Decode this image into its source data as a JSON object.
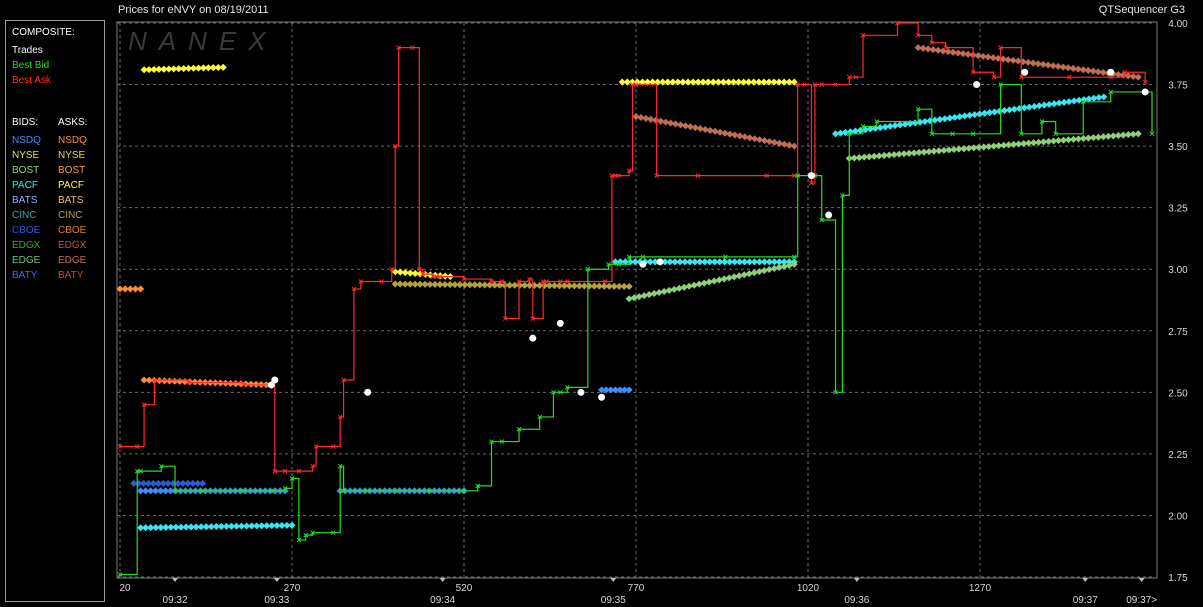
{
  "header": {
    "title": "Prices for  eNVY  on  08/19/2011",
    "product": "QTSequencer G3"
  },
  "watermark": "NANEX",
  "legend": {
    "composite_title": "COMPOSITE:",
    "composite_items": [
      {
        "label": "Trades",
        "color": "#ffffff"
      },
      {
        "label": "Best Bid",
        "color": "#22e022"
      },
      {
        "label": "Best Ask",
        "color": "#ff2a2a"
      }
    ],
    "bids_title": "BIDS:",
    "asks_title": "ASKS:",
    "exchanges": [
      {
        "bid": "NSDQ",
        "bid_color": "#3f8cff",
        "ask": "NSDQ",
        "ask_color": "#ff8a3a"
      },
      {
        "bid": "NYSE",
        "bid_color": "#d8e640",
        "ask": "NYSE",
        "ask_color": "#f2d35a"
      },
      {
        "bid": "BOST",
        "bid_color": "#8ed17a",
        "ask": "BOST",
        "ask_color": "#ff9a58"
      },
      {
        "bid": "PACF",
        "bid_color": "#37e6f2",
        "ask": "PACF",
        "ask_color": "#ffff3a"
      },
      {
        "bid": "BATS",
        "bid_color": "#8ab4ff",
        "ask": "BATS",
        "ask_color": "#e8c286"
      },
      {
        "bid": "CINC",
        "bid_color": "#3aa3a3",
        "ask": "CINC",
        "ask_color": "#b5a040"
      },
      {
        "bid": "CBOE",
        "bid_color": "#2a5cd0",
        "ask": "CBOE",
        "ask_color": "#d8862c"
      },
      {
        "bid": "EDGX",
        "bid_color": "#3aa832",
        "ask": "EDGX",
        "ask_color": "#b85a2a"
      },
      {
        "bid": "EDGE",
        "bid_color": "#6ac882",
        "ask": "EDGE",
        "ask_color": "#c06e56"
      },
      {
        "bid": "BATY",
        "bid_color": "#3f6fe0",
        "ask": "BATY",
        "ask_color": "#c2503a"
      }
    ]
  },
  "chart_data": {
    "type": "scatter",
    "title": "Prices for  eNVY  on  08/19/2011",
    "ylim": [
      1.75,
      4.0
    ],
    "xlim": [
      20,
      1520
    ],
    "y_ticks": [
      "1.75",
      "2.00",
      "2.25",
      "2.50",
      "2.75",
      "3.00",
      "3.25",
      "3.50",
      "3.75",
      "4.00"
    ],
    "y_tick_values": [
      1.75,
      2.0,
      2.25,
      2.5,
      2.75,
      3.0,
      3.25,
      3.5,
      3.75,
      4.0
    ],
    "x_ticks": [
      "20",
      "270",
      "520",
      "770",
      "1020",
      "1270"
    ],
    "x_tick_values": [
      20,
      270,
      520,
      770,
      1020,
      1270
    ],
    "time_labels": [
      {
        "label": "09:32",
        "x": 100
      },
      {
        "label": "09:33",
        "x": 248
      },
      {
        "label": "09:34",
        "x": 489
      },
      {
        "label": "09:35",
        "x": 737
      },
      {
        "label": "09:36",
        "x": 1091
      },
      {
        "label": "09:37",
        "x": 1423
      },
      {
        "label": "09:37>",
        "x": 1505
      }
    ],
    "grid": true,
    "series": [
      {
        "name": "Best Ask",
        "color": "#ff2a2a",
        "x": [
          20,
          45,
          55,
          70,
          120,
          200,
          240,
          245,
          260,
          280,
          300,
          305,
          330,
          340,
          345,
          360,
          370,
          400,
          415,
          420,
          425,
          445,
          455,
          460,
          475,
          480,
          485,
          520,
          560,
          575,
          580,
          600,
          615,
          620,
          635,
          640,
          660,
          670,
          725,
          735,
          740,
          745,
          760,
          765,
          770,
          800,
          860,
          960,
          1000,
          1005,
          1015,
          1025,
          1030,
          1040,
          1060,
          1080,
          1090,
          1100,
          1150,
          1180,
          1200,
          1220,
          1260,
          1290,
          1300,
          1330,
          1400,
          1460,
          1480,
          1510
        ],
        "y": [
          2.28,
          2.28,
          2.45,
          2.55,
          2.54,
          2.53,
          2.53,
          2.18,
          2.18,
          2.18,
          2.2,
          2.28,
          2.28,
          2.4,
          2.55,
          2.92,
          2.95,
          2.95,
          3.0,
          3.5,
          3.9,
          3.9,
          3.0,
          2.98,
          2.97,
          2.97,
          2.97,
          2.96,
          2.95,
          2.95,
          2.8,
          2.95,
          2.96,
          2.8,
          2.95,
          2.95,
          2.95,
          2.95,
          2.95,
          3.38,
          3.38,
          3.38,
          3.4,
          3.75,
          3.75,
          3.38,
          3.38,
          3.38,
          3.38,
          3.75,
          3.75,
          3.35,
          3.75,
          3.75,
          3.75,
          3.78,
          3.78,
          3.95,
          4.0,
          3.95,
          3.92,
          3.9,
          3.8,
          3.78,
          3.9,
          3.78,
          3.78,
          3.78,
          3.8,
          3.76
        ]
      },
      {
        "name": "Best Bid",
        "color": "#22e022",
        "x": [
          20,
          45,
          50,
          80,
          100,
          140,
          200,
          240,
          260,
          270,
          280,
          290,
          300,
          330,
          340,
          345,
          380,
          420,
          470,
          520,
          540,
          560,
          575,
          600,
          630,
          650,
          660,
          670,
          700,
          730,
          745,
          760,
          780,
          900,
          1000,
          1005,
          1030,
          1040,
          1060,
          1070,
          1080,
          1100,
          1120,
          1180,
          1200,
          1230,
          1260,
          1300,
          1330,
          1360,
          1380,
          1420,
          1460,
          1520
        ],
        "y": [
          1.76,
          2.18,
          2.18,
          2.2,
          2.1,
          2.1,
          2.1,
          2.1,
          2.11,
          2.15,
          1.9,
          1.92,
          1.93,
          1.93,
          2.2,
          2.1,
          2.1,
          2.1,
          2.1,
          2.1,
          2.12,
          2.3,
          2.3,
          2.35,
          2.4,
          2.5,
          2.5,
          2.52,
          3.0,
          3.02,
          3.02,
          3.05,
          3.05,
          3.05,
          3.05,
          3.38,
          3.38,
          3.2,
          2.5,
          3.3,
          3.55,
          3.58,
          3.6,
          3.65,
          3.55,
          3.55,
          3.55,
          3.75,
          3.55,
          3.6,
          3.55,
          3.68,
          3.72,
          3.55
        ]
      },
      {
        "name": "Trades",
        "color": "#ffffff",
        "x": [
          240,
          245,
          380,
          620,
          660,
          690,
          720,
          780,
          805,
          1025,
          1050,
          1265,
          1335,
          1460,
          1510
        ],
        "y": [
          2.53,
          2.55,
          2.5,
          2.72,
          2.78,
          2.5,
          2.48,
          3.02,
          3.03,
          3.38,
          3.22,
          3.75,
          3.8,
          3.8,
          3.72
        ]
      }
    ],
    "exchange_quote_bands": [
      {
        "name": "NYSE asks",
        "color": "#ffff3a",
        "x": [
          55,
          170
        ],
        "y": [
          3.81,
          3.82
        ]
      },
      {
        "name": "NYSE asks",
        "color": "#ffff3a",
        "x": [
          420,
          500
        ],
        "y": [
          2.99,
          2.97
        ]
      },
      {
        "name": "NYSE asks",
        "color": "#ffff3a",
        "x": [
          750,
          1000
        ],
        "y": [
          3.76,
          3.76
        ]
      },
      {
        "name": "EDGE asks",
        "color": "#c06e56",
        "x": [
          770,
          1000
        ],
        "y": [
          3.62,
          3.5
        ]
      },
      {
        "name": "EDGE asks",
        "color": "#c06e56",
        "x": [
          1180,
          1500
        ],
        "y": [
          3.9,
          3.78
        ]
      },
      {
        "name": "NSDQ asks",
        "color": "#ff8a3a",
        "x": [
          55,
          240
        ],
        "y": [
          2.55,
          2.53
        ]
      },
      {
        "name": "NSDQ asks",
        "color": "#ff8a3a",
        "x": [
          20,
          50
        ],
        "y": [
          2.92,
          2.92
        ]
      },
      {
        "name": "CINC asks",
        "color": "#b5a040",
        "x": [
          420,
          760
        ],
        "y": [
          2.94,
          2.93
        ]
      },
      {
        "name": "PACF bids",
        "color": "#37e6f2",
        "x": [
          740,
          1000
        ],
        "y": [
          3.03,
          3.03
        ]
      },
      {
        "name": "PACF bids",
        "color": "#37e6f2",
        "x": [
          1060,
          1450
        ],
        "y": [
          3.55,
          3.7
        ]
      },
      {
        "name": "PACF bids",
        "color": "#37e6f2",
        "x": [
          50,
          270
        ],
        "y": [
          1.95,
          1.96
        ]
      },
      {
        "name": "BOST bids",
        "color": "#8ed17a",
        "x": [
          760,
          1000
        ],
        "y": [
          2.88,
          3.02
        ]
      },
      {
        "name": "BOST bids",
        "color": "#8ed17a",
        "x": [
          1080,
          1500
        ],
        "y": [
          3.45,
          3.55
        ]
      },
      {
        "name": "NSDQ bids",
        "color": "#3f8cff",
        "x": [
          50,
          260
        ],
        "y": [
          2.1,
          2.1
        ]
      },
      {
        "name": "NSDQ bids",
        "color": "#3f8cff",
        "x": [
          340,
          520
        ],
        "y": [
          2.1,
          2.1
        ]
      },
      {
        "name": "CBOE bids",
        "color": "#2a5cd0",
        "x": [
          40,
          140
        ],
        "y": [
          2.13,
          2.13
        ]
      },
      {
        "name": "NSDQ bids",
        "color": "#3f8cff",
        "x": [
          720,
          760
        ],
        "y": [
          2.51,
          2.51
        ]
      }
    ]
  }
}
